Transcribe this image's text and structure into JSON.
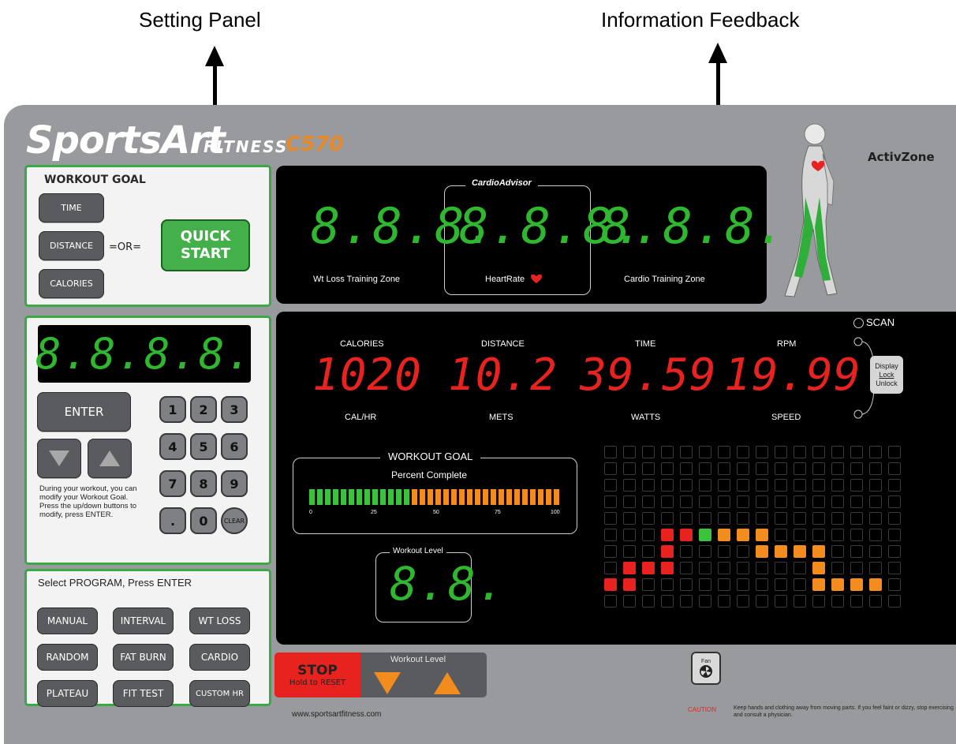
{
  "annotations": {
    "setting_panel": "Setting Panel",
    "information_feedback": "Information Feedback"
  },
  "brand": {
    "name": "SportsArt",
    "sub": "FITNESS",
    "model": "C570",
    "activzone": "ActivZone"
  },
  "workout_goal": {
    "title": "WORKOUT GOAL",
    "time": "TIME",
    "distance": "DISTANCE",
    "calories": "CALORIES",
    "or": "=OR=",
    "quick_start_line1": "QUICK",
    "quick_start_line2": "START"
  },
  "keypad": {
    "display": "8.8.8.8.",
    "enter": "ENTER",
    "keys": [
      "1",
      "2",
      "3",
      "4",
      "5",
      "6",
      "7",
      "8",
      "9",
      ".",
      "0",
      "CLEAR"
    ],
    "help_text": "During your workout, you can modify your Workout Goal. Press the up/down buttons to modify, press ENTER."
  },
  "program": {
    "title": "Select PROGRAM, Press ENTER",
    "buttons": [
      "MANUAL",
      "INTERVAL",
      "WT LOSS",
      "RANDOM",
      "FAT BURN",
      "CARDIO",
      "PLATEAU",
      "FIT TEST",
      "CUSTOM HR"
    ]
  },
  "cardio_advisor": {
    "title": "CardioAdvisor",
    "left_value": "8.8.8.",
    "left_label": "Wt Loss Training Zone",
    "center_value": "8.8.8.",
    "center_label": "HeartRate",
    "right_value": "8.8.8.",
    "right_label": "Cardio Training Zone"
  },
  "readouts": [
    {
      "top": "CALORIES",
      "value": "1020",
      "bottom": "CAL/HR"
    },
    {
      "top": "DISTANCE",
      "value": "10.2",
      "bottom": "METS"
    },
    {
      "top": "TIME",
      "value": "39.59",
      "bottom": "WATTS"
    },
    {
      "top": "RPM",
      "value": "19.99",
      "bottom": "SPEED"
    }
  ],
  "scan": {
    "label": "SCAN",
    "button_line1": "Display",
    "button_line2": "Lock",
    "button_line3": "Unlock"
  },
  "progress": {
    "title": "WORKOUT GOAL",
    "subtitle": "Percent Complete",
    "ticks": [
      "0",
      "25",
      "50",
      "75",
      "100"
    ],
    "complete_fraction": 0.4,
    "green_color": "#3cc23c",
    "orange_color": "#f28c1c"
  },
  "workout_level_display": {
    "title": "Workout Level",
    "value": "8.8."
  },
  "level_profile": {
    "columns": 16,
    "rows": 10,
    "lit": [
      {
        "col": 0,
        "row": 8,
        "color": "#e8231f"
      },
      {
        "col": 1,
        "row": 8,
        "color": "#e8231f"
      },
      {
        "col": 1,
        "row": 7,
        "color": "#e8231f"
      },
      {
        "col": 2,
        "row": 7,
        "color": "#e8231f"
      },
      {
        "col": 3,
        "row": 7,
        "color": "#e8231f"
      },
      {
        "col": 3,
        "row": 6,
        "color": "#e8231f"
      },
      {
        "col": 3,
        "row": 5,
        "color": "#e8231f"
      },
      {
        "col": 4,
        "row": 5,
        "color": "#e8231f"
      },
      {
        "col": 5,
        "row": 5,
        "color": "#3cc23c"
      },
      {
        "col": 6,
        "row": 5,
        "color": "#f28c1c"
      },
      {
        "col": 7,
        "row": 5,
        "color": "#f28c1c"
      },
      {
        "col": 8,
        "row": 5,
        "color": "#f28c1c"
      },
      {
        "col": 8,
        "row": 6,
        "color": "#f28c1c"
      },
      {
        "col": 9,
        "row": 6,
        "color": "#f28c1c"
      },
      {
        "col": 10,
        "row": 6,
        "color": "#f28c1c"
      },
      {
        "col": 11,
        "row": 6,
        "color": "#f28c1c"
      },
      {
        "col": 11,
        "row": 7,
        "color": "#f28c1c"
      },
      {
        "col": 11,
        "row": 8,
        "color": "#f28c1c"
      },
      {
        "col": 12,
        "row": 8,
        "color": "#f28c1c"
      },
      {
        "col": 13,
        "row": 8,
        "color": "#f28c1c"
      },
      {
        "col": 14,
        "row": 8,
        "color": "#f28c1c"
      }
    ]
  },
  "bottom": {
    "stop_line1": "STOP",
    "stop_line2": "Hold to RESET",
    "workout_level_label": "Workout Level",
    "website": "www.sportsartfitness.com",
    "fan": "Fan",
    "caution_word": "CAUTION",
    "caution_text": "Keep hands and clothing away from moving parts. If you feel faint or dizzy, stop exercising and consult a physician."
  }
}
